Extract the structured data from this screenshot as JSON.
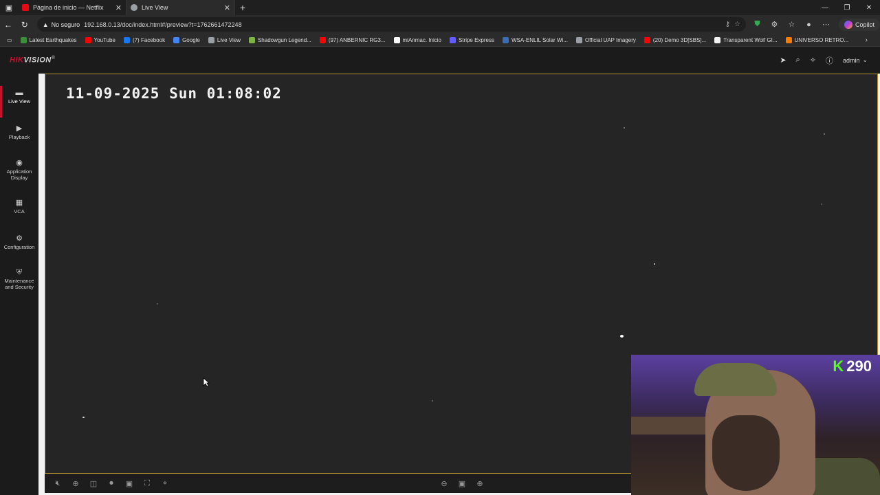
{
  "browser": {
    "tabs": [
      {
        "title": "Página de inicio — Netflix",
        "color": "#e50914",
        "active": false
      },
      {
        "title": "Live View",
        "color": "#9aa0a6",
        "active": true
      }
    ],
    "security_label": "No seguro",
    "url": "192.168.0.13/doc/index.html#/preview?t=1762661472248",
    "copilot_label": "Copilot",
    "bookmarks": [
      {
        "label": "Latest Earthquakes",
        "color": "#3c8d3c"
      },
      {
        "label": "YouTube",
        "color": "#ff0000"
      },
      {
        "label": "(7) Facebook",
        "color": "#1877f2"
      },
      {
        "label": "Google",
        "color": "#4285f4"
      },
      {
        "label": "Live View",
        "color": "#9aa0a6"
      },
      {
        "label": "Shadowgun Legend...",
        "color": "#7cb342"
      },
      {
        "label": "(97) ANBERNIC RG3...",
        "color": "#ff0000"
      },
      {
        "label": "miAnmac. Inicio",
        "color": "#ffffff"
      },
      {
        "label": "Stripe Express",
        "color": "#635bff"
      },
      {
        "label": "WSA-ENLIL Solar Wi...",
        "color": "#3b6db4"
      },
      {
        "label": "Official UAP Imagery",
        "color": "#9aa0a6"
      },
      {
        "label": "(20) Demo 3D[SBS]...",
        "color": "#ff0000"
      },
      {
        "label": "Transparent Wolf GI...",
        "color": "#f2f2f2"
      },
      {
        "label": "UNIVERSO RETRO...",
        "color": "#f57c00"
      }
    ]
  },
  "app": {
    "logo_main": "HIK",
    "logo_rest": "VISION",
    "logo_mark": "®",
    "user": "admin",
    "nav": [
      {
        "label": "Live View",
        "icon": "live-view-icon",
        "active": true
      },
      {
        "label": "Playback",
        "icon": "playback-icon",
        "active": false
      },
      {
        "label": "Application Display",
        "icon": "application-display-icon",
        "active": false
      },
      {
        "label": "VCA",
        "icon": "vca-icon",
        "active": false
      },
      {
        "label": "Configuration",
        "icon": "configuration-icon",
        "active": false
      },
      {
        "label": "Maintenance and Security",
        "icon": "maintenance-icon",
        "active": false
      }
    ],
    "osd_timestamp": "11-09-2025 Sun 01:08:02"
  },
  "overlay": {
    "viewer_count": "290",
    "platform_letter": "K",
    "accent": "#53fc18"
  }
}
